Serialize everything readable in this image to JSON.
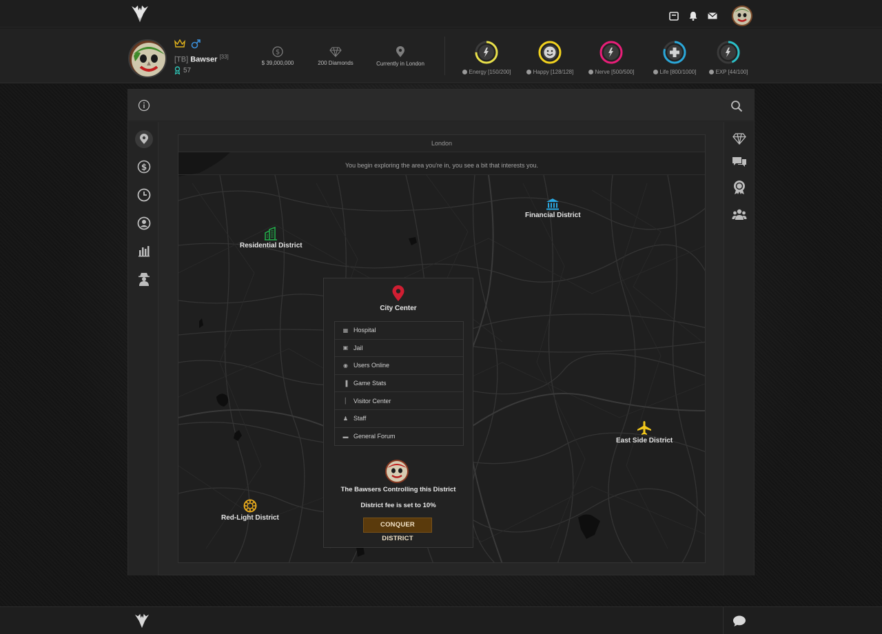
{
  "header": {
    "icons": [
      "logo-icon",
      "store-icon",
      "bell-icon",
      "mail-icon"
    ]
  },
  "profile": {
    "tag": "[TB]",
    "name": "Bawser",
    "age": "[33]",
    "level": "57",
    "money": "$ 39,000,000",
    "diamonds": "200 Diamonds",
    "location": "Currently in London"
  },
  "gauges": [
    {
      "name": "energy",
      "label": "Energy [150/200]",
      "color": "#e8e04a",
      "fraction": 0.75,
      "icon": "bolt-icon"
    },
    {
      "name": "happy",
      "label": "Happy [128/128]",
      "color": "#f2d21e",
      "fraction": 1.0,
      "icon": "smile-icon"
    },
    {
      "name": "nerve",
      "label": "Nerve [500/500]",
      "color": "#e81e78",
      "fraction": 1.0,
      "icon": "bolt-icon"
    },
    {
      "name": "life",
      "label": "Life [800/1000]",
      "color": "#2aa7d9",
      "fraction": 0.8,
      "icon": "plus-icon"
    },
    {
      "name": "exp",
      "label": "EXP [44/100]",
      "color": "#2ac0c8",
      "fraction": 0.44,
      "icon": "bolt-icon"
    }
  ],
  "map": {
    "title": "London",
    "note": "You begin exploring the area you're in, you see a bit that interests you.",
    "districts": {
      "residential": {
        "label": "Residential District",
        "color": "#22b14c"
      },
      "financial": {
        "label": "Financial District",
        "color": "#29a7e0"
      },
      "eastside": {
        "label": "East Side District",
        "color": "#f2c81c"
      },
      "redlight": {
        "label": "Red-Light District",
        "color": "#f2b11c"
      }
    }
  },
  "city_center": {
    "title": "City Center",
    "items": [
      {
        "label": "Hospital",
        "icon": "hospital-icon"
      },
      {
        "label": "Jail",
        "icon": "jail-icon"
      },
      {
        "label": "Users Online",
        "icon": "signal-icon"
      },
      {
        "label": "Game Stats",
        "icon": "bar-chart-icon"
      },
      {
        "label": "Visitor Center",
        "icon": "thermometer-icon"
      },
      {
        "label": "Staff",
        "icon": "staff-icon"
      },
      {
        "label": "General Forum",
        "icon": "chat-icon"
      }
    ],
    "controller": "The Bawsers Controlling this District",
    "fee": "District fee is set to 10%",
    "button": "CONQUER DISTRICT"
  }
}
